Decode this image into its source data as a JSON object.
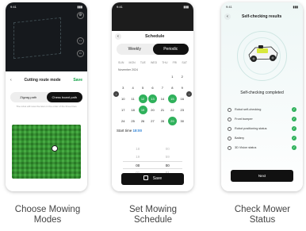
{
  "phone1": {
    "time": "9:41",
    "header": {
      "back": "‹",
      "title": "Cutting route mode",
      "save": "Save"
    },
    "modes": [
      "Zigzag path",
      "Chess board path"
    ],
    "active_mode": "Chess board path",
    "note": "The robot will mow the lawn in the order of the three-lines",
    "icons": [
      "pin-icon",
      "gear-icon",
      "route-icon",
      "home-icon"
    ]
  },
  "phone2": {
    "time": "9:41",
    "header": {
      "back": "‹",
      "title": "Schedule"
    },
    "tabs": [
      "Weekly",
      "Periodic"
    ],
    "active_tab": "Periodic",
    "weekdays": [
      "SUN",
      "MON",
      "TUE",
      "WED",
      "THU",
      "FRI",
      "SAT"
    ],
    "month": "November 2024",
    "days": [
      "",
      "",
      "",
      "",
      "",
      "1",
      "2",
      "3",
      "4",
      "5",
      "6",
      "7",
      "8",
      "9",
      "10",
      "11",
      "12",
      "13",
      "14",
      "15",
      "16",
      "17",
      "18",
      "19",
      "20",
      "21",
      "22",
      "23",
      "24",
      "25",
      "26",
      "27",
      "28",
      "29",
      "30"
    ],
    "selected_days": [
      "12",
      "13",
      "15",
      "19",
      "29"
    ],
    "start_time": {
      "label": "Start time",
      "value": "18:00"
    },
    "picker_rows": [
      [
        "",
        ""
      ],
      [
        "18",
        "00"
      ],
      [
        "19",
        "59"
      ],
      [
        "00",
        "00"
      ],
      [
        "01",
        "01"
      ]
    ],
    "save_label": "Save"
  },
  "phone3": {
    "time": "9:41",
    "header": {
      "back": "‹",
      "title": "Self-checking results"
    },
    "status": "Self-checking completed",
    "items": [
      "Robot self-checking",
      "Front bumper",
      "Robot positioning status",
      "Battery",
      "3D Vision status"
    ],
    "next_label": "Next"
  },
  "captions": [
    [
      "Choose Mowing",
      "Modes"
    ],
    [
      "Set Mowing",
      "Schedule"
    ],
    [
      "Check Mower",
      "Status"
    ]
  ],
  "colors": {
    "accent_green": "#2fb15b",
    "dark": "#111111",
    "link_blue": "#2f83d8"
  }
}
